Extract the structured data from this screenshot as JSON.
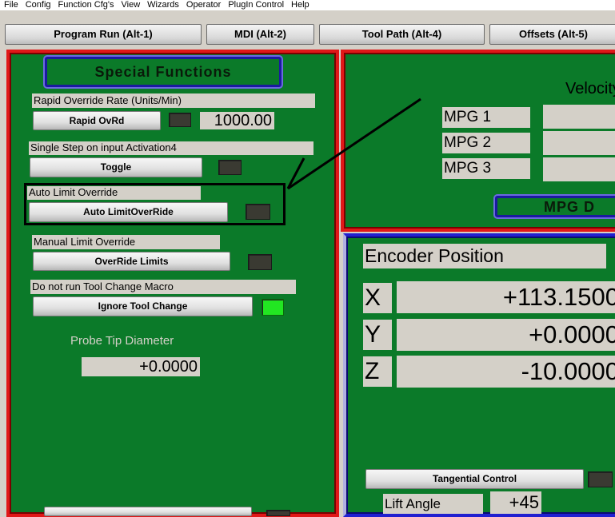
{
  "menu": [
    "File",
    "Config",
    "Function Cfg's",
    "View",
    "Wizards",
    "Operator",
    "PlugIn Control",
    "Help"
  ],
  "tabs": [
    "Program Run (Alt-1)",
    "MDI (Alt-2)",
    "Tool Path (Alt-4)",
    "Offsets (Alt-5)"
  ],
  "special": {
    "title": "Special Functions",
    "rapid_label": "Rapid Override Rate (Units/Min)",
    "rapid_button": "Rapid OvRd",
    "rapid_value": "1000.00",
    "single_step_label": "Single Step on input Activation4",
    "toggle_button": "Toggle",
    "auto_limit_label": "Auto Limit Override",
    "auto_limit_button": "Auto LimitOverRide",
    "manual_limit_label": "Manual Limit Override",
    "override_button": "OverRide Limits",
    "tool_change_label": "Do not run Tool Change Macro",
    "tool_change_button": "Ignore Tool Change",
    "probe_label": "Probe Tip Diameter",
    "probe_value": "+0.0000"
  },
  "mpg": {
    "velocity_label": "Velocity",
    "rows": [
      "MPG 1",
      "MPG 2",
      "MPG 3"
    ],
    "button": "MPG D"
  },
  "encoder": {
    "title": "Encoder Position",
    "axes": [
      {
        "axis": "X",
        "value": "+113.1500"
      },
      {
        "axis": "Y",
        "value": "+0.0000"
      },
      {
        "axis": "Z",
        "value": "-10.0000"
      }
    ],
    "tangential_button": "Tangential Control",
    "lift_angle_label": "Lift Angle",
    "lift_angle_value": "+45"
  },
  "colors": {
    "panel_green": "#0b7a29",
    "frame_red": "#e01818",
    "frame_blue": "#2020d0",
    "led_on": "#22e622",
    "led_off": "#3a3a32"
  }
}
